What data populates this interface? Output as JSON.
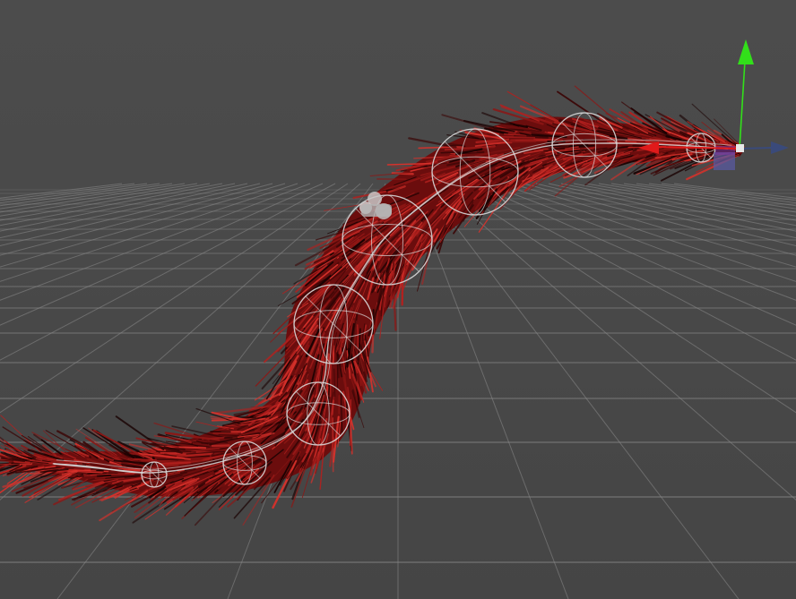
{
  "scene": {
    "view": "perspective-3d-viewport",
    "background_color": "#484848",
    "grid_color": "#8a8a8a",
    "tail_mesh": {
      "name": "fur-tail",
      "base_color": "#6b0d0d",
      "strand_colors": [
        "#b3201e",
        "#8e1614",
        "#d8312b",
        "#3b0606",
        "#1a0202"
      ]
    },
    "bone_gizmo_color": "#d9d9d9",
    "bone_count": 9,
    "transform_gizmo": {
      "y_axis_color": "#32e01a",
      "x_axis_color": "#e01a1a",
      "z_axis_color": "#3a4a7a",
      "center_color": "#5a5aa0"
    },
    "icons": [
      "move-tool-icon",
      "camera-icon"
    ]
  }
}
